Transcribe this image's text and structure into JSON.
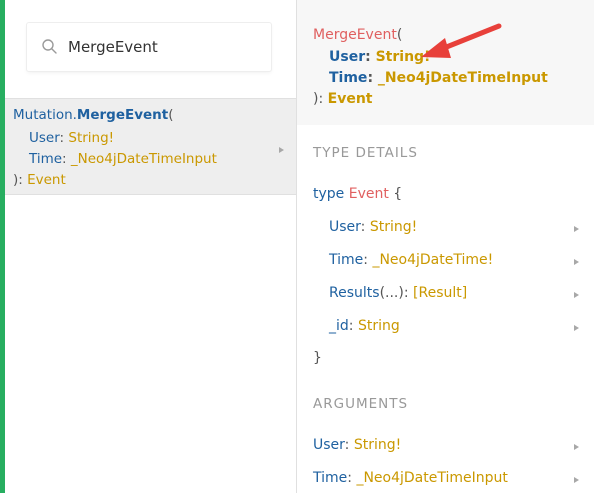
{
  "search": {
    "value": "MergeEvent"
  },
  "result": {
    "prefix": "Mutation.",
    "name": "MergeEvent",
    "open_paren": "(",
    "args": [
      {
        "name": "User",
        "sep": ": ",
        "type": "String!"
      },
      {
        "name": "Time",
        "sep": ": ",
        "type": "_Neo4jDateTimeInput"
      }
    ],
    "close": "): ",
    "return_type": "Event"
  },
  "doc": {
    "header": {
      "name": "MergeEvent",
      "open_paren": "(",
      "args": [
        {
          "name": "User",
          "sep": ": ",
          "type": "String!"
        },
        {
          "name": "Time",
          "sep": ": ",
          "type": "_Neo4jDateTimeInput"
        }
      ],
      "close": "): ",
      "return_type": "Event"
    },
    "type_details": {
      "title": "TYPE DETAILS",
      "keyword": "type",
      "type_name": "Event",
      "open_brace": "{",
      "fields": [
        {
          "name": "User",
          "sep": ": ",
          "type": "String!"
        },
        {
          "name": "Time",
          "sep": ": ",
          "type": "_Neo4jDateTime!"
        },
        {
          "name": "Results",
          "args": "(...)",
          "sep": ": ",
          "type": "[Result]"
        },
        {
          "name": "_id",
          "sep": ": ",
          "type": "String"
        }
      ],
      "close_brace": "}"
    },
    "arguments": {
      "title": "ARGUMENTS",
      "items": [
        {
          "name": "User",
          "sep": ": ",
          "type": "String!"
        },
        {
          "name": "Time",
          "sep": ": ",
          "type": "_Neo4jDateTimeInput"
        }
      ]
    }
  },
  "colors": {
    "accent_bar": "#27ae60",
    "annotation_arrow": "#e8403a",
    "field": "#1f61a0",
    "type": "#ca9800",
    "mutation_name": "#e06060"
  },
  "icons": {
    "search": "search-icon",
    "expand": "chevron-right-icon",
    "annotation": "red-arrow-icon"
  }
}
